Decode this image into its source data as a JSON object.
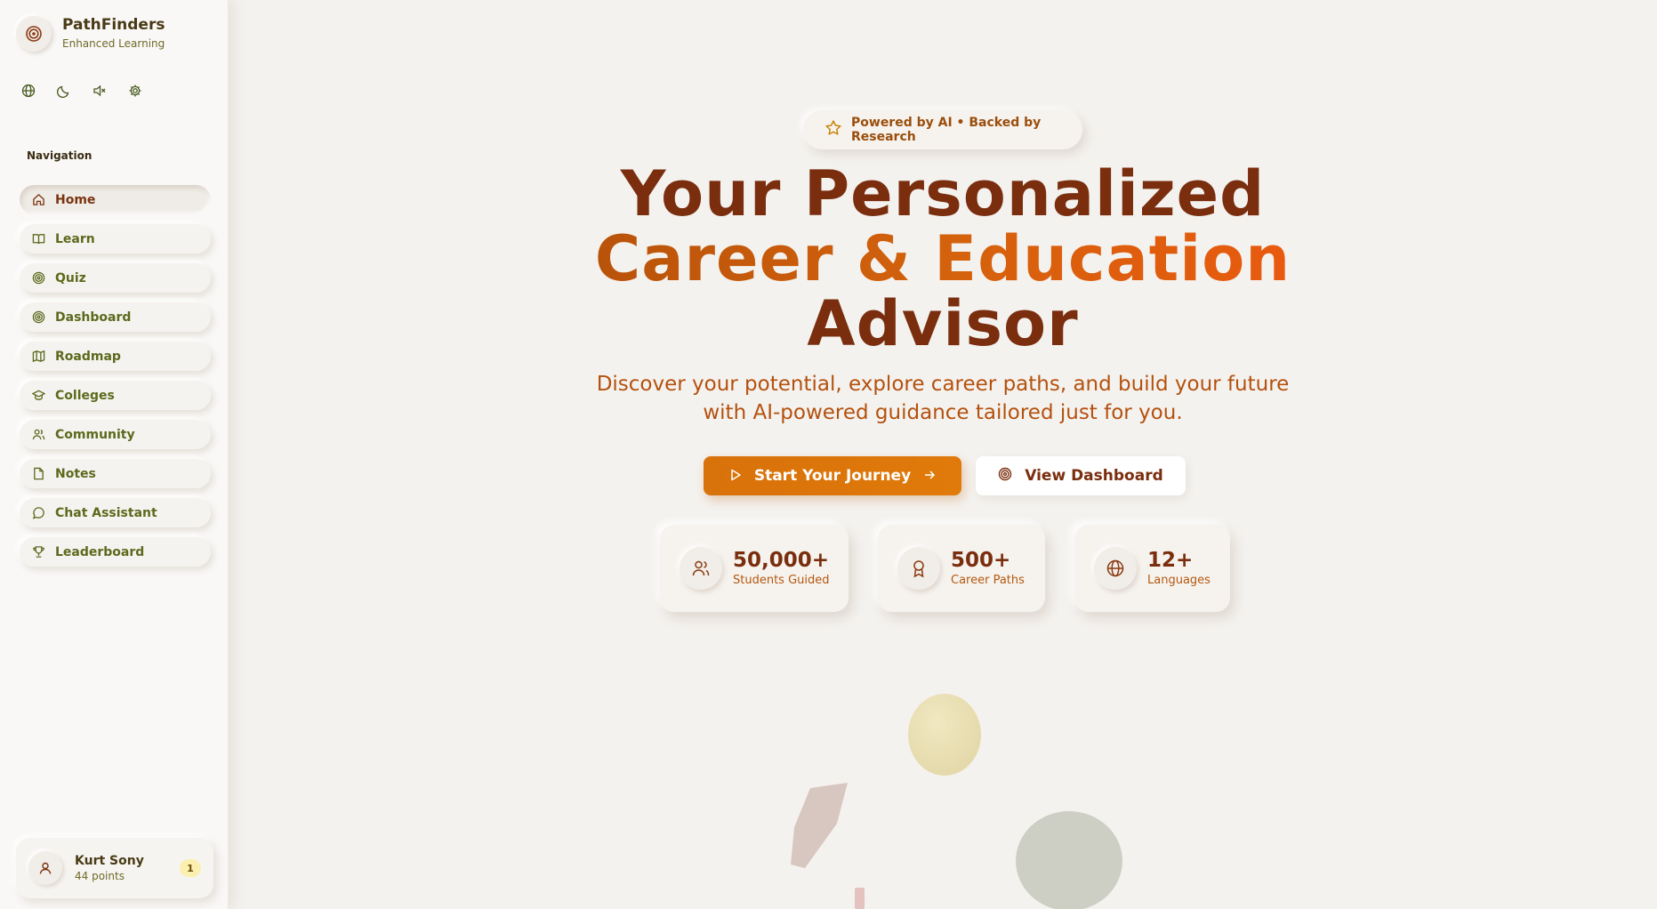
{
  "brand": {
    "name": "PathFinders",
    "subtitle": "Enhanced Learning",
    "logo_icon": "target-icon"
  },
  "toolbar": {
    "icons": [
      "globe-icon",
      "moon-icon",
      "volume-mute-icon",
      "settings-icon"
    ]
  },
  "sidebar": {
    "heading": "Navigation",
    "items": [
      {
        "label": "Home",
        "icon": "home-icon",
        "active": true
      },
      {
        "label": "Learn",
        "icon": "book-icon"
      },
      {
        "label": "Quiz",
        "icon": "target-icon"
      },
      {
        "label": "Dashboard",
        "icon": "target-icon"
      },
      {
        "label": "Roadmap",
        "icon": "map-icon"
      },
      {
        "label": "Colleges",
        "icon": "graduation-cap-icon"
      },
      {
        "label": "Community",
        "icon": "users-icon"
      },
      {
        "label": "Notes",
        "icon": "file-icon"
      },
      {
        "label": "Chat Assistant",
        "icon": "chat-icon"
      },
      {
        "label": "Leaderboard",
        "icon": "trophy-icon"
      }
    ]
  },
  "user": {
    "name": "Kurt Sony",
    "points": "44 points",
    "rank": "1"
  },
  "hero": {
    "badge": "Powered by AI • Backed by Research",
    "title_line1": "Your Personalized",
    "title_line2": "Career & Education",
    "title_line3": "Advisor",
    "subtitle": "Discover your potential, explore career paths, and build your future with AI-powered guidance tailored just for you.",
    "primary_cta": "Start Your Journey",
    "secondary_cta": "View Dashboard"
  },
  "stats": [
    {
      "value": "50,000+",
      "label": "Students Guided",
      "icon": "users-icon"
    },
    {
      "value": "500+",
      "label": "Career Paths",
      "icon": "award-icon"
    },
    {
      "value": "12+",
      "label": "Languages",
      "icon": "globe-icon"
    }
  ],
  "colors": {
    "accent": "#e07a0a",
    "title": "#7a2e0e",
    "nav_text": "#5c6a1c",
    "background": "#f4f2ef"
  }
}
